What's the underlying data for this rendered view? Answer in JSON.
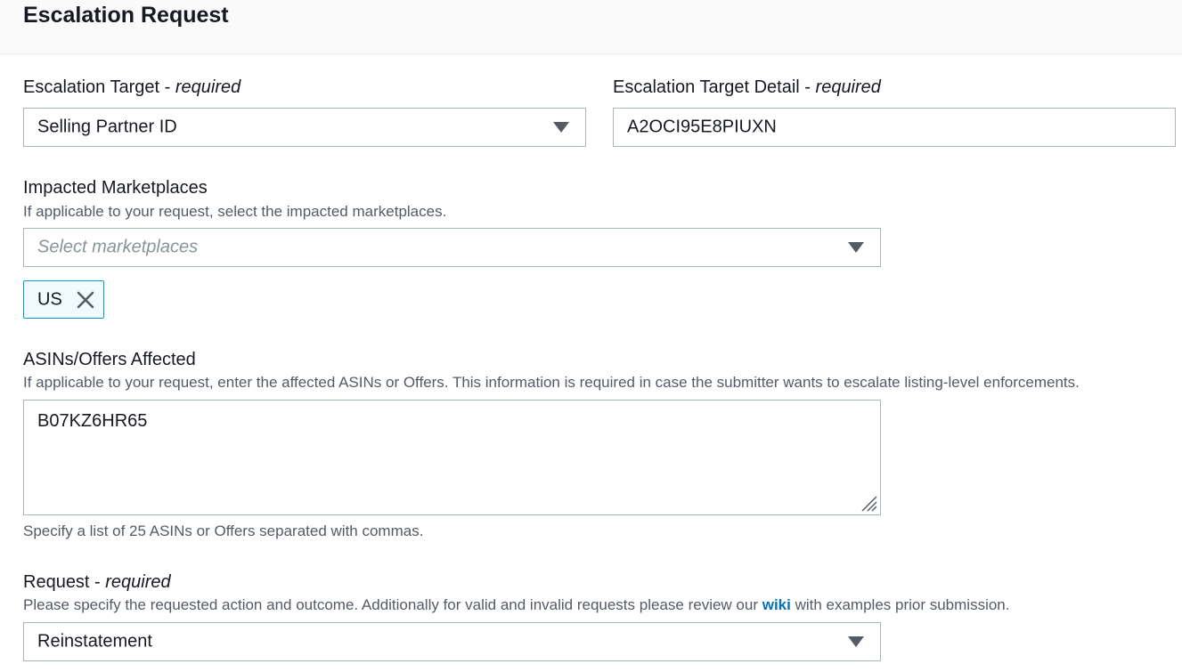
{
  "header": {
    "title": "Escalation Request"
  },
  "escalation_target": {
    "label": "Escalation Target - ",
    "required": "required",
    "value": "Selling Partner ID"
  },
  "escalation_target_detail": {
    "label": "Escalation Target Detail - ",
    "required": "required",
    "value": "A2OCI95E8PIUXN"
  },
  "marketplaces": {
    "label": "Impacted Marketplaces",
    "description": "If applicable to your request, select the impacted marketplaces.",
    "placeholder": "Select marketplaces",
    "tokens": [
      "US"
    ]
  },
  "asins": {
    "label": "ASINs/Offers Affected",
    "description": "If applicable to your request, enter the affected ASINs or Offers. This information is required in case the submitter wants to escalate listing-level enforcements.",
    "value": "B07KZ6HR65",
    "hint": "Specify a list of 25 ASINs or Offers separated with commas."
  },
  "request": {
    "label": "Request - ",
    "required": "required",
    "description_before": "Please specify the requested action and outcome. Additionally for valid and invalid requests please review our ",
    "link": "wiki",
    "description_after": " with examples prior submission.",
    "value": "Reinstatement"
  },
  "icons": {
    "dropdown": "caret-down-icon",
    "remove": "close-icon",
    "resize": "resize-handle-icon"
  },
  "colors": {
    "link": "#0073bb",
    "token_border": "#00a1c9",
    "token_background": "#f1faff"
  }
}
